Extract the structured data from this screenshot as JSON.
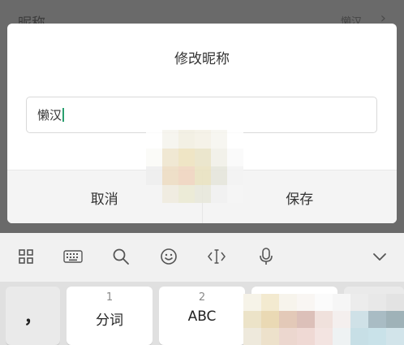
{
  "background": {
    "row_label": "昵称",
    "row_value": "懒汉",
    "chevron": "›"
  },
  "dialog": {
    "title": "修改昵称",
    "input_value": "懒汉",
    "cancel_label": "取消",
    "save_label": "保存"
  },
  "keyboard": {
    "toolbar_icons": [
      "grid-icon",
      "keyboard-icon",
      "search-icon",
      "emoji-icon",
      "cursor-icon",
      "microphone-icon",
      "chevron-down-icon"
    ],
    "keys": [
      {
        "num": "",
        "label": "，"
      },
      {
        "num": "1",
        "label": "分词"
      },
      {
        "num": "2",
        "label": "ABC"
      },
      {
        "num": "",
        "label": ""
      },
      {
        "num": "",
        "label": ""
      }
    ]
  },
  "colors": {
    "accent": "#2a9f6f",
    "dim_overlay": "#5f5f5f"
  }
}
